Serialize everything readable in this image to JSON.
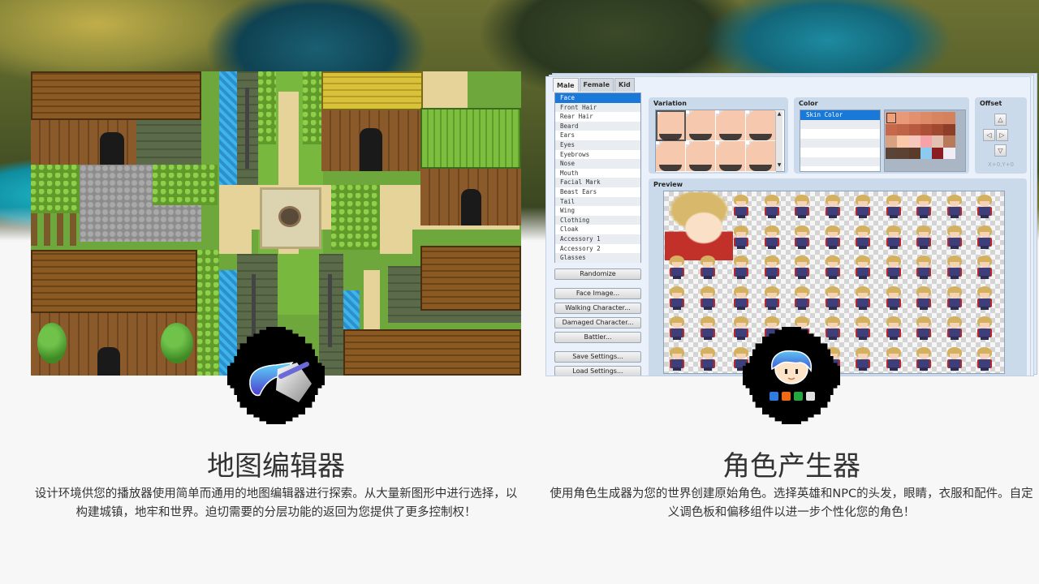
{
  "features": [
    {
      "id": "map-editor",
      "title": "地图编辑器",
      "description": "设计环境供您的播放器使用简单而通用的地图编辑器进行探索。从大量新图形中进行选择，以构建城镇，地牢和世界。迫切需要的分层功能的返回为您提供了更多控制权！",
      "badge_icon": "paint-bucket-icon",
      "screenshot": "map-editor-screenshot"
    },
    {
      "id": "character-generator",
      "title": "角色产生器",
      "description": "使用角色生成器为您的世界创建原始角色。选择英雄和NPC的头发，眼睛，衣服和配件。自定义调色板和偏移组件以进一步个性化您的角色！",
      "badge_icon": "character-face-icon",
      "screenshot": "character-generator-screenshot"
    }
  ],
  "char_gen": {
    "tabs": [
      {
        "label": "Male",
        "active": true
      },
      {
        "label": "Female",
        "active": false
      },
      {
        "label": "Kid",
        "active": false
      }
    ],
    "parts": [
      {
        "label": "Face",
        "selected": true
      },
      {
        "label": "Front Hair"
      },
      {
        "label": "Rear Hair"
      },
      {
        "label": "Beard"
      },
      {
        "label": "Ears"
      },
      {
        "label": "Eyes"
      },
      {
        "label": "Eyebrows"
      },
      {
        "label": "Nose"
      },
      {
        "label": "Mouth"
      },
      {
        "label": "Facial Mark"
      },
      {
        "label": "Beast Ears"
      },
      {
        "label": "Tail"
      },
      {
        "label": "Wing"
      },
      {
        "label": "Clothing"
      },
      {
        "label": "Cloak"
      },
      {
        "label": "Accessory 1"
      },
      {
        "label": "Accessory 2"
      },
      {
        "label": "Glasses"
      }
    ],
    "buttons": {
      "randomize": "Randomize",
      "face_image": "Face Image...",
      "walking_character": "Walking Character...",
      "damaged_character": "Damaged Character...",
      "battler": "Battler...",
      "save_settings": "Save Settings...",
      "load_settings": "Load Settings..."
    },
    "variation": {
      "title": "Variation",
      "scroll_up": "▲",
      "scroll_down": "▼"
    },
    "color": {
      "title": "Color",
      "items": [
        "Skin Color",
        "",
        "",
        "",
        "",
        ""
      ],
      "selected_index": 0,
      "swatches": [
        "#f0a07a",
        "#e8997a",
        "#e3906e",
        "#dd8a66",
        "#d88460",
        "#d4825e",
        "#c8684a",
        "#c06448",
        "#b85a40",
        "#ac5038",
        "#a04830",
        "#8e3e28",
        "#d8a282",
        "#fbc8a8",
        "#f7c6bc",
        "#f4a4a8",
        "#e4c0b0",
        "#b87a5a",
        "#5a4438",
        "#5c4232",
        "#5a3a28",
        "#8ccaf0",
        "#8a1e22",
        "#f0eef4"
      ]
    },
    "offset": {
      "title": "Offset",
      "up": "△",
      "left": "◁",
      "right": "▷",
      "down": "▽",
      "readout": "X+0,Y+0"
    },
    "preview": {
      "title": "Preview"
    }
  },
  "colors": {
    "page_bg": "#f7f7f7",
    "text": "#333333",
    "selection_blue": "#1a78d8",
    "panel_blue": "#cbdaeb"
  }
}
